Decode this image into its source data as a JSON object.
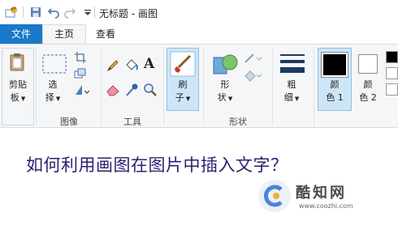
{
  "window": {
    "title": "无标题 - 画图"
  },
  "quick_access": {
    "items": [
      "paint-app-icon",
      "save-icon",
      "undo-icon",
      "redo-icon",
      "customize-dropdown-icon"
    ]
  },
  "tabs": [
    {
      "label": "文件",
      "active": false
    },
    {
      "label": "主页",
      "active": true
    },
    {
      "label": "查看",
      "active": false
    }
  ],
  "ribbon": {
    "clipboard": {
      "paste_line1": "剪贴",
      "paste_line2": "板",
      "group_label": ""
    },
    "image": {
      "select_line1": "选",
      "select_line2": "择",
      "group_label": "图像"
    },
    "tools": {
      "group_label": "工具"
    },
    "brushes": {
      "line1": "刷",
      "line2": "子"
    },
    "shapes": {
      "line1": "形",
      "line2": "状",
      "group_label": "形状"
    },
    "size": {
      "line1": "粗",
      "line2": "细"
    },
    "colors": {
      "color1_line1": "颜",
      "color1_line2": "色 1",
      "color2_line1": "颜",
      "color2_line2": "色 2",
      "color1_value": "#000000",
      "color2_value": "#ffffff"
    }
  },
  "canvas": {
    "text": "如何利用画图在图片中插入文字？"
  },
  "watermark": {
    "name": "酷知网",
    "url": "www.coozhi.com"
  },
  "colors": {
    "accent": "#1979ca",
    "ribbon_bg": "#f5f6f7",
    "selected_bg": "#cde6f7",
    "canvas_text": "#2b2270"
  }
}
